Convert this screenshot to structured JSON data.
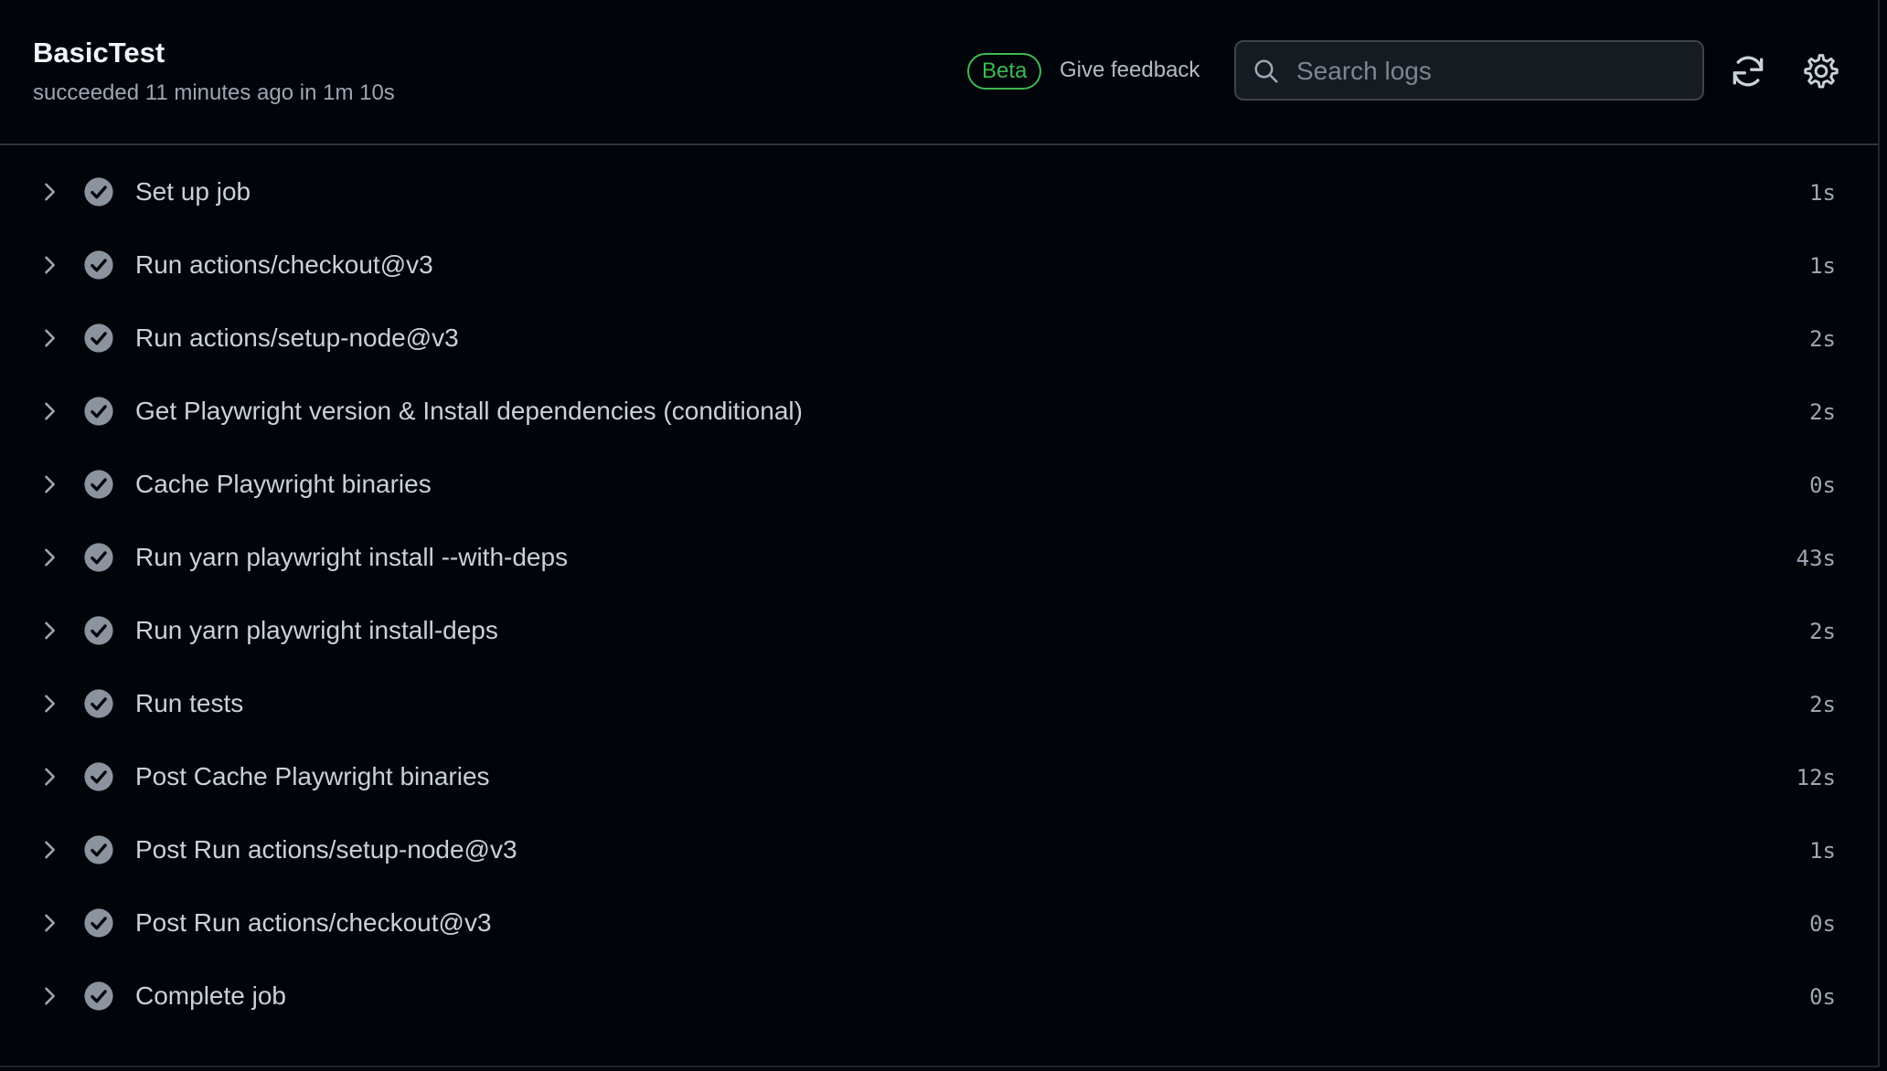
{
  "header": {
    "title": "BasicTest",
    "subtitle": "succeeded 11 minutes ago in 1m 10s",
    "beta_label": "Beta",
    "feedback_label": "Give feedback",
    "search": {
      "placeholder": "Search logs",
      "value": ""
    },
    "icons": {
      "search": "search-icon",
      "refresh": "sync-icon",
      "settings": "gear-icon"
    }
  },
  "colors": {
    "background": "#010409",
    "accent_success": "#3fb950",
    "status_icon": "#8b949e"
  },
  "steps": [
    {
      "name": "Set up job",
      "duration": "1s"
    },
    {
      "name": "Run actions/checkout@v3",
      "duration": "1s"
    },
    {
      "name": "Run actions/setup-node@v3",
      "duration": "2s"
    },
    {
      "name": "Get Playwright version & Install dependencies (conditional)",
      "duration": "2s"
    },
    {
      "name": "Cache Playwright binaries",
      "duration": "0s"
    },
    {
      "name": "Run yarn playwright install --with-deps",
      "duration": "43s"
    },
    {
      "name": "Run yarn playwright install-deps",
      "duration": "2s"
    },
    {
      "name": "Run tests",
      "duration": "2s"
    },
    {
      "name": "Post Cache Playwright binaries",
      "duration": "12s"
    },
    {
      "name": "Post Run actions/setup-node@v3",
      "duration": "1s"
    },
    {
      "name": "Post Run actions/checkout@v3",
      "duration": "0s"
    },
    {
      "name": "Complete job",
      "duration": "0s"
    }
  ]
}
